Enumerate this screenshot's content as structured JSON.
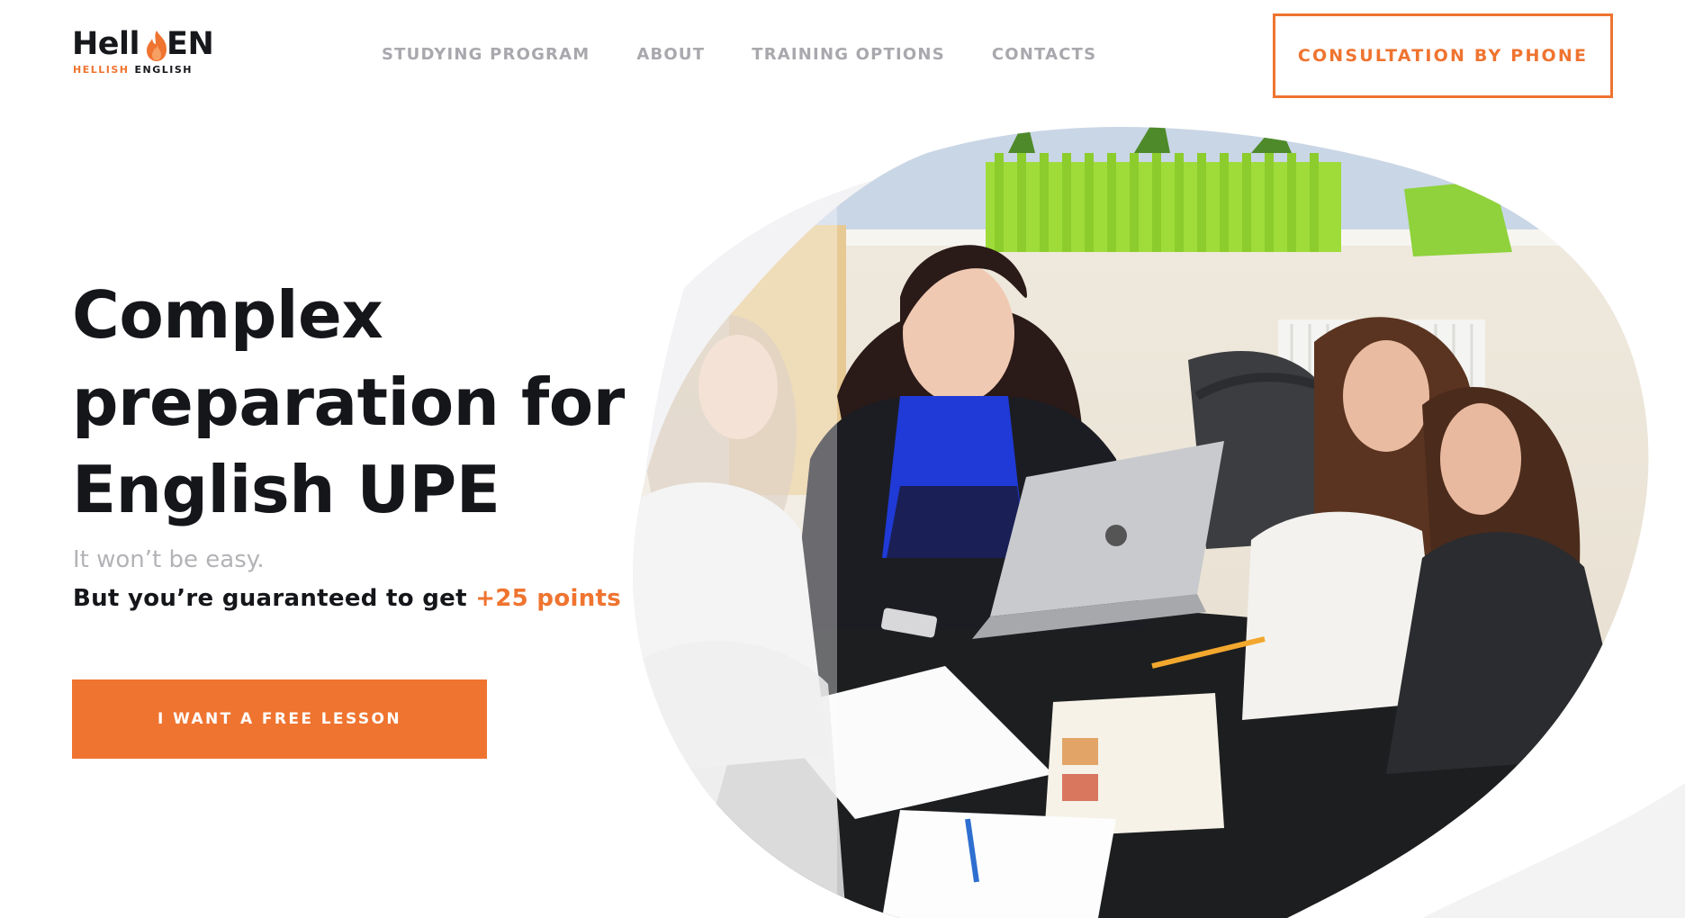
{
  "brand": {
    "logo_word_left": "Hell",
    "logo_word_right": "EN",
    "tagline_1": "HELLISH",
    "tagline_2": "ENGLISH",
    "accent_color": "#ef7430",
    "text_color": "#15161a"
  },
  "nav": {
    "items": [
      {
        "label": "STUDYING PROGRAM"
      },
      {
        "label": "ABOUT"
      },
      {
        "label": "TRAINING OPTIONS"
      },
      {
        "label": "CONTACTS"
      }
    ]
  },
  "header": {
    "phone_button": "CONSULTATION BY PHONE"
  },
  "hero": {
    "title_line_1": "Complex",
    "title_line_2": "preparation for",
    "title_line_3": "English UPE",
    "subtitle_1": "It won’t be easy.",
    "subtitle_2_prefix": "But you’re guaranteed to get ",
    "subtitle_2_accent": "+25 points",
    "cta_button": "I WANT A FREE LESSON"
  },
  "photo": {
    "description_icon": "classroom-photo"
  }
}
